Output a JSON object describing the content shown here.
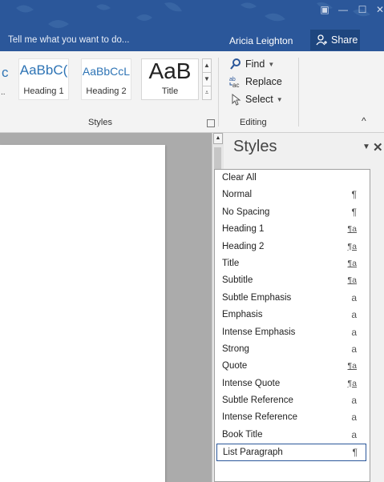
{
  "topbar": {
    "tell_me": "Tell me what you want to do...",
    "user": "Aricia Leighton",
    "share": "Share"
  },
  "ribbon": {
    "gallery_cut_label": "c",
    "gallery": [
      {
        "sample": "AaBbC(",
        "label": "Heading 1"
      },
      {
        "sample": "AaBbCcL",
        "label": "Heading 2"
      },
      {
        "sample": "AaB",
        "label": "Title"
      }
    ],
    "styles_group_label": "Styles",
    "editing": {
      "find": "Find",
      "replace": "Replace",
      "select": "Select",
      "group_label": "Editing"
    }
  },
  "styles_pane": {
    "title": "Styles",
    "clear_all": "Clear All",
    "items": [
      {
        "name": "Normal",
        "kind": "¶",
        "type": "paragraph"
      },
      {
        "name": "No Spacing",
        "kind": "¶",
        "type": "paragraph"
      },
      {
        "name": "Heading 1",
        "kind": "¶a",
        "type": "linked"
      },
      {
        "name": "Heading 2",
        "kind": "¶a",
        "type": "linked"
      },
      {
        "name": "Title",
        "kind": "¶a",
        "type": "linked"
      },
      {
        "name": "Subtitle",
        "kind": "¶a",
        "type": "linked"
      },
      {
        "name": "Subtle Emphasis",
        "kind": "a",
        "type": "character"
      },
      {
        "name": "Emphasis",
        "kind": "a",
        "type": "character"
      },
      {
        "name": "Intense Emphasis",
        "kind": "a",
        "type": "character"
      },
      {
        "name": "Strong",
        "kind": "a",
        "type": "character"
      },
      {
        "name": "Quote",
        "kind": "¶a",
        "type": "linked"
      },
      {
        "name": "Intense Quote",
        "kind": "¶a",
        "type": "linked"
      },
      {
        "name": "Subtle Reference",
        "kind": "a",
        "type": "character"
      },
      {
        "name": "Intense Reference",
        "kind": "a",
        "type": "character"
      },
      {
        "name": "Book Title",
        "kind": "a",
        "type": "character"
      },
      {
        "name": "List Paragraph",
        "kind": "¶",
        "type": "paragraph",
        "selected": true
      }
    ]
  },
  "colors": {
    "title_bar": "#2b579a",
    "heading_text": "#2e74b5",
    "selection_border": "#2b579a"
  }
}
